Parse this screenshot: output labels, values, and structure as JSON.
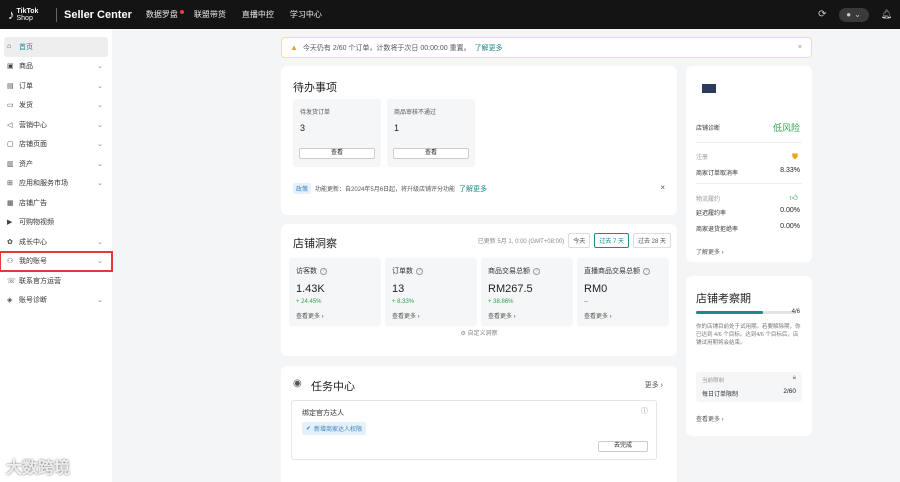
{
  "topbar": {
    "logo_text_1": "TikTok",
    "logo_text_2": "Shop",
    "brand": "Seller Center",
    "nav": [
      "数据罗盘",
      "联盟带货",
      "直播中控",
      "学习中心"
    ],
    "chat_icon": "chat-icon",
    "accent": "#1a8a8a"
  },
  "sidebar": {
    "items": [
      {
        "label": "首页",
        "icon": "home-icon",
        "chevron": false
      },
      {
        "label": "商品",
        "icon": "box-icon",
        "chevron": true
      },
      {
        "label": "订单",
        "icon": "order-icon",
        "chevron": true
      },
      {
        "label": "发货",
        "icon": "truck-icon",
        "chevron": true
      },
      {
        "label": "营销中心",
        "icon": "megaphone-icon",
        "chevron": true
      },
      {
        "label": "店铺页面",
        "icon": "store-icon",
        "chevron": true
      },
      {
        "label": "资产",
        "icon": "wallet-icon",
        "chevron": true
      },
      {
        "label": "应用和服务市场",
        "icon": "apps-icon",
        "chevron": true
      },
      {
        "label": "店铺广告",
        "icon": "ad-icon",
        "chevron": false
      },
      {
        "label": "可购物视频",
        "icon": "video-icon",
        "chevron": false
      },
      {
        "label": "成长中心",
        "icon": "growth-icon",
        "chevron": true
      },
      {
        "label": "我的账号",
        "icon": "user-icon",
        "chevron": true
      },
      {
        "label": "联系官方运营",
        "icon": "support-icon",
        "chevron": false
      },
      {
        "label": "账号诊断",
        "icon": "diagnose-icon",
        "chevron": true
      }
    ]
  },
  "banner": {
    "text": "今天仍有 2/60 个订单，计数将于次日 00:00:00 重置。",
    "link": "了解更多"
  },
  "todo": {
    "title": "待办事项",
    "boxes": [
      {
        "label": "待发货订单",
        "value": "3",
        "button": "查看"
      },
      {
        "label": "商品审核不通过",
        "value": "1",
        "button": "查看"
      }
    ],
    "notice_tag": "政策",
    "notice_text": "功能更新：自2024年5月6日起，将升级店铺评分功能",
    "notice_link": "了解更多"
  },
  "insights": {
    "title": "店铺洞察",
    "updated": "已更新 5月 1, 0:00 (GMT+08:00)",
    "ranges": [
      "今天",
      "过去 7 天",
      "过去 28 天"
    ],
    "stats": [
      {
        "label": "访客数",
        "value": "1.43K",
        "change": "+ 24.45%",
        "more": "查看更多"
      },
      {
        "label": "订单数",
        "value": "13",
        "change": "+ 8.33%",
        "more": "查看更多"
      },
      {
        "label": "商品交易总额",
        "value": "RM267.5",
        "change": "+ 38.86%",
        "more": "查看更多"
      },
      {
        "label": "直播商品交易总额",
        "value": "RM0",
        "change": "--",
        "more": "查看更多"
      }
    ],
    "custom": "自定义洞察"
  },
  "tasks": {
    "title": "任务中心",
    "more": "更多",
    "item_title": "绑定官方达人",
    "item_badge": "新增商家达人权限",
    "item_button": "去完成"
  },
  "health": {
    "label": "店铺诊断",
    "status": "低风险",
    "metrics": [
      {
        "group": "注册",
        "label": "商家订单取消率",
        "value": "8.33%"
      },
      {
        "group": "物流履约",
        "label": "延迟履约率",
        "value": "0.00%"
      },
      {
        "label": "商家退货拒绝率",
        "value": "0.00%"
      }
    ],
    "more": "了解更多"
  },
  "probation": {
    "title": "店铺考察期",
    "progress_text": "4/6",
    "progress": 0.6667,
    "desc": "你的店铺目前处于试用期。若要解除期，你已达到 4/6 个目标。达到4/6 个目标后，店铺试用期将会结束。",
    "limit_label": "当前限制",
    "limit_item": "每日订单限制",
    "limit_value": "2/60",
    "more": "查看更多"
  },
  "watermark": "大数跨境"
}
